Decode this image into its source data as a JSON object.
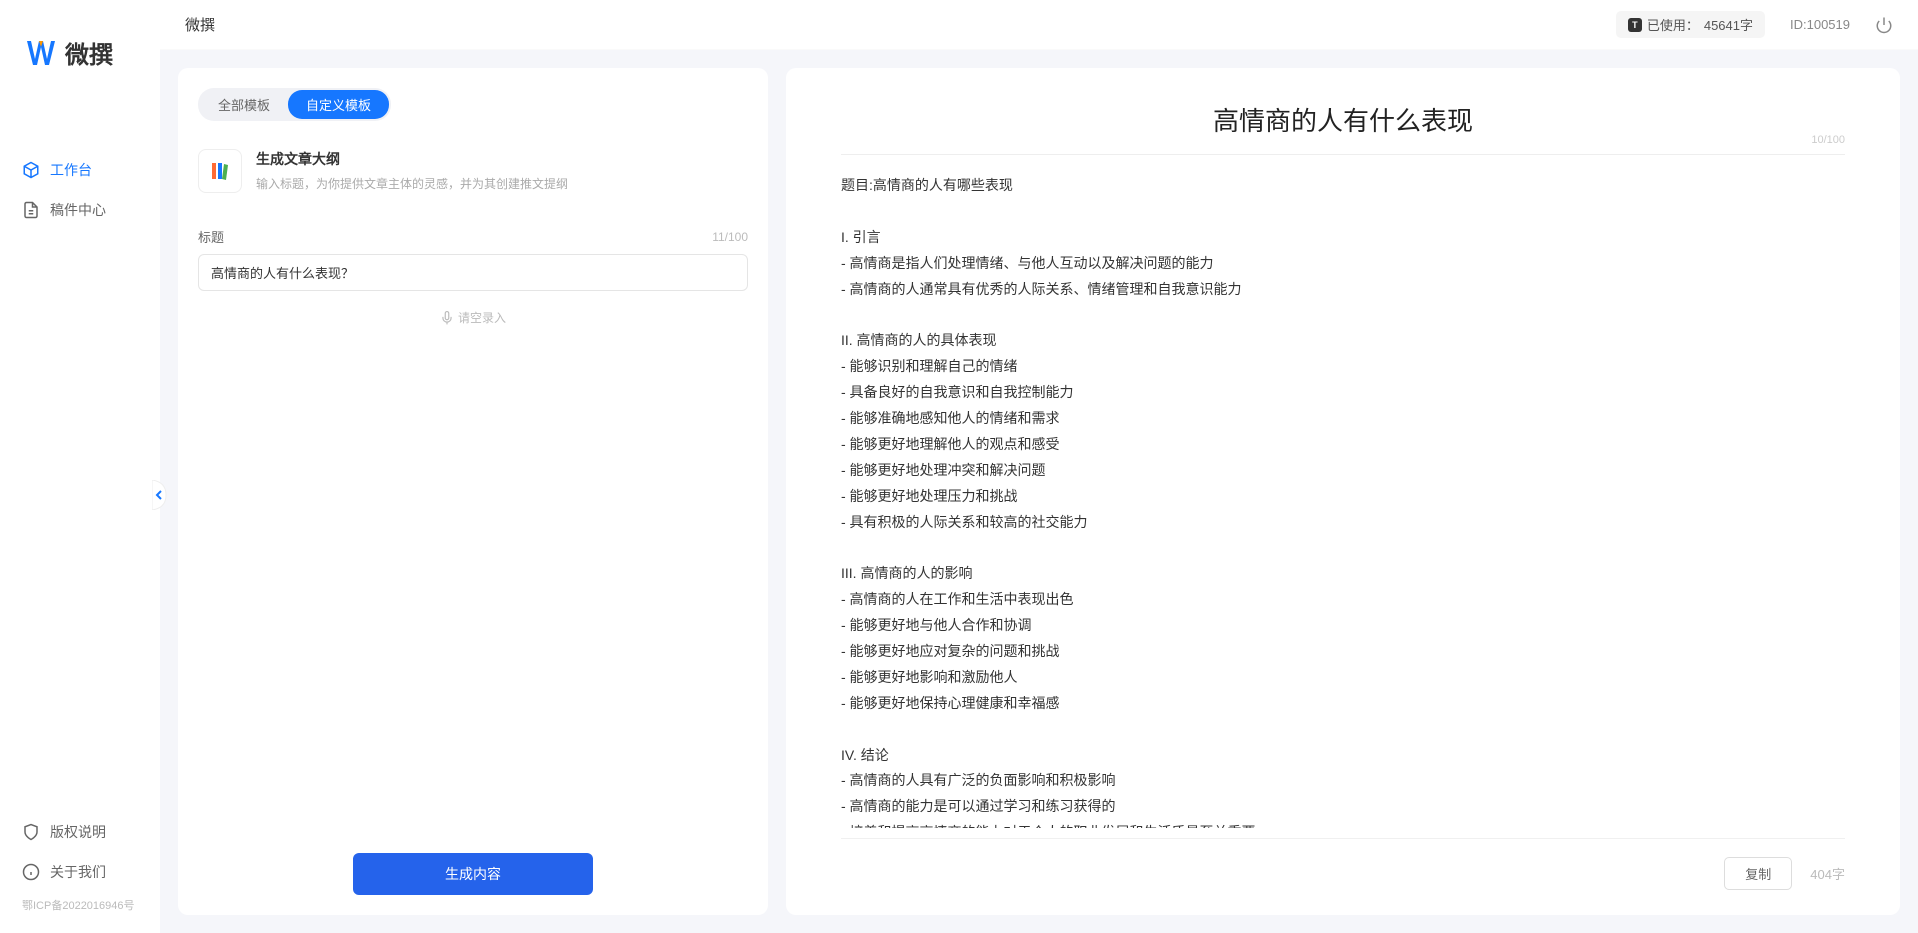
{
  "app_name": "微撰",
  "header": {
    "title": "微撰",
    "usage_label": "已使用：",
    "usage_value": "45641字",
    "user_id": "ID:100519"
  },
  "sidebar": {
    "nav": [
      {
        "label": "工作台",
        "active": true
      },
      {
        "label": "稿件中心",
        "active": false
      }
    ],
    "footer": [
      {
        "label": "版权说明"
      },
      {
        "label": "关于我们"
      }
    ],
    "icp": "鄂ICP备2022016946号"
  },
  "left_panel": {
    "tabs": [
      {
        "label": "全部模板",
        "active": false
      },
      {
        "label": "自定义模板",
        "active": true
      }
    ],
    "template": {
      "title": "生成文章大纲",
      "desc": "输入标题，为你提供文章主体的灵感，并为其创建推文提纲"
    },
    "form": {
      "label": "标题",
      "counter": "11/100",
      "value": "高情商的人有什么表现？",
      "voice_label": "请空录入"
    },
    "generate_btn": "生成内容"
  },
  "right_panel": {
    "title": "高情商的人有什么表现",
    "title_counter": "10/100",
    "body": "题目:高情商的人有哪些表现\n\nI. 引言\n- 高情商是指人们处理情绪、与他人互动以及解决问题的能力\n- 高情商的人通常具有优秀的人际关系、情绪管理和自我意识能力\n\nII. 高情商的人的具体表现\n- 能够识别和理解自己的情绪\n- 具备良好的自我意识和自我控制能力\n- 能够准确地感知他人的情绪和需求\n- 能够更好地理解他人的观点和感受\n- 能够更好地处理冲突和解决问题\n- 能够更好地处理压力和挑战\n- 具有积极的人际关系和较高的社交能力\n\nIII. 高情商的人的影响\n- 高情商的人在工作和生活中表现出色\n- 能够更好地与他人合作和协调\n- 能够更好地应对复杂的问题和挑战\n- 能够更好地影响和激励他人\n- 能够更好地保持心理健康和幸福感\n\nIV. 结论\n- 高情商的人具有广泛的负面影响和积极影响\n- 高情商的能力是可以通过学习和练习获得的\n- 培养和提高高情商的能力对于个人的职业发展和生活质量至关重要。",
    "copy_btn": "复制",
    "word_count": "404字"
  }
}
